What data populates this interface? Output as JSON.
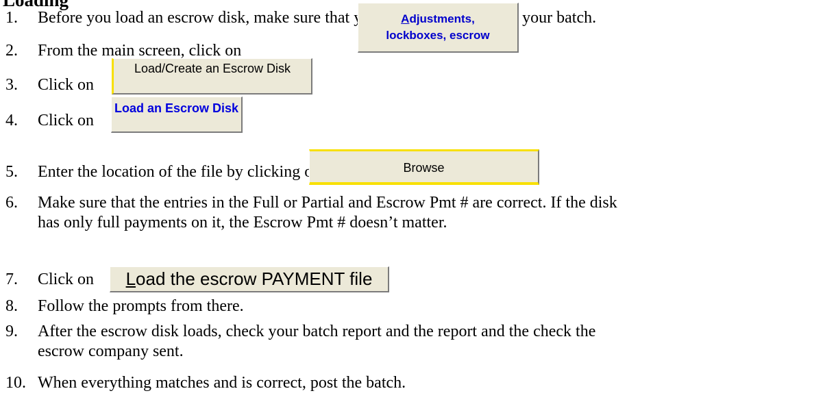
{
  "heading": "Loading",
  "steps": {
    "s1": {
      "num": "1.",
      "text": "Before you load an escrow disk, make sure that you have no payments in your batch."
    },
    "s2": {
      "num": "2.",
      "text": "From the main screen, click on"
    },
    "s3": {
      "num": "3.",
      "text": "Click on"
    },
    "s4": {
      "num": "4.",
      "text": "Click on"
    },
    "s5": {
      "num": "5.",
      "text": "Enter the location of the file by clicking on"
    },
    "s6": {
      "num": "6.",
      "text": "Make sure that the entries in the Full or Partial and Escrow Pmt # are correct.  If the disk",
      "cont": "has only full payments on it, the Escrow Pmt # doesn’t matter."
    },
    "s7": {
      "num": "7.",
      "text": "Click on"
    },
    "s8": {
      "num": "8.",
      "text": "Follow the prompts from there."
    },
    "s9": {
      "num": "9.",
      "text": "After the escrow disk loads, check your batch report and the report and the check the",
      "cont": "escrow company sent."
    },
    "s10": {
      "num": "10.",
      "text": "When everything matches and is correct, post the batch."
    }
  },
  "buttons": {
    "adjustments": {
      "underline_char": "A",
      "rest_line1": "djustments,",
      "line2": "lockboxes, escrow"
    },
    "load_create": "Load/Create an Escrow Disk",
    "load_disk": "Load an Escrow Disk",
    "browse": "Browse",
    "load_payment": {
      "underline_char": "L",
      "rest": "oad the escrow PAYMENT file"
    }
  }
}
